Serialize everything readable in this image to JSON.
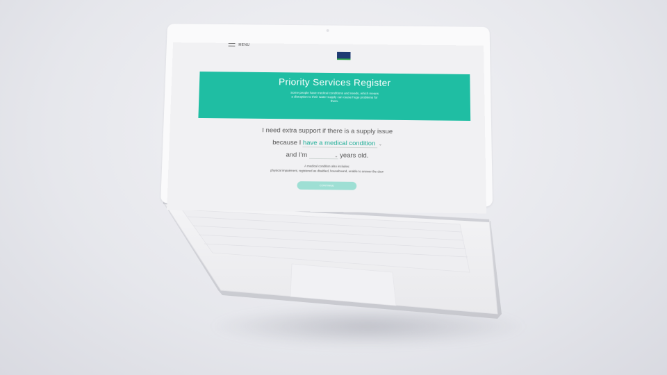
{
  "header": {
    "menu_label": "MENU"
  },
  "hero": {
    "title": "Priority Services Register",
    "subtitle": "Some people have medical conditions and needs, which means a disruption to their water supply can cause huge problems for them."
  },
  "form": {
    "line1": "I need extra support if there is a supply issue",
    "line2_prefix": "because I",
    "reason_value": "have a medical condition",
    "line3_prefix": "and I'm",
    "line3_suffix": "years old.",
    "note_line1": "A medical condition also includes:",
    "note_line2": "physical impairment, registered as disabled, housebound, unable to answer the door",
    "continue_label": "CONTINUE"
  },
  "colors": {
    "accent": "#1fbea3",
    "button": "#9edfd4",
    "background": "#e6e7ec"
  }
}
